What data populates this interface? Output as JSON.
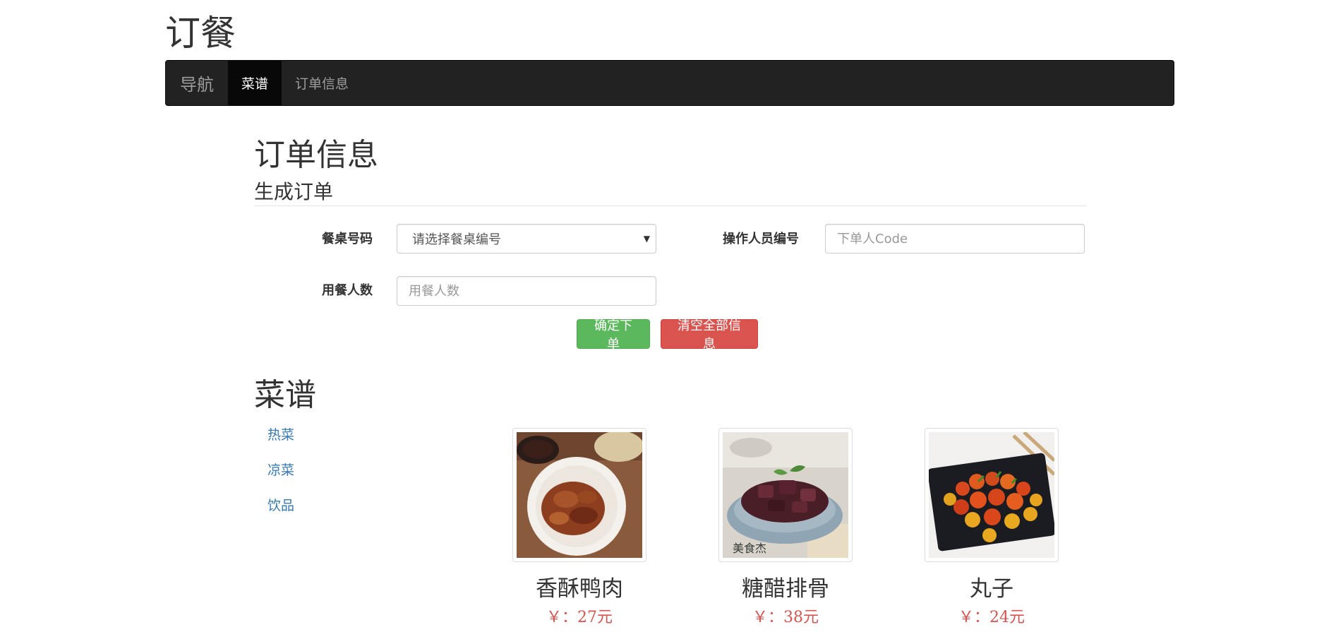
{
  "app": {
    "title": "订餐"
  },
  "nav": {
    "brand": "导航",
    "items": [
      {
        "label": "菜谱",
        "active": true
      },
      {
        "label": "订单信息",
        "active": false
      }
    ]
  },
  "order": {
    "title": "订单信息",
    "subtitle": "生成订单",
    "table_label": "餐桌号码",
    "table_select_value": "请选择餐桌编号",
    "operator_label": "操作人员编号",
    "operator_placeholder": "下单人Code",
    "diners_label": "用餐人数",
    "diners_placeholder": "用餐人数",
    "submit_label": "确定下单",
    "clear_label": "清空全部信息"
  },
  "menu": {
    "title": "菜谱",
    "categories": [
      "热菜",
      "凉菜",
      "饮品"
    ],
    "dishes": [
      {
        "name": "香酥鸭肉",
        "price": "￥：27元"
      },
      {
        "name": "糖醋排骨",
        "price": "￥：38元"
      },
      {
        "name": "丸子",
        "price": "￥：24元"
      }
    ]
  },
  "colors": {
    "navbar_bg": "#222222",
    "nav_active_bg": "#080808",
    "link": "#337ab7",
    "success": "#5cb85c",
    "danger": "#d9534f",
    "price": "#d9534f"
  }
}
